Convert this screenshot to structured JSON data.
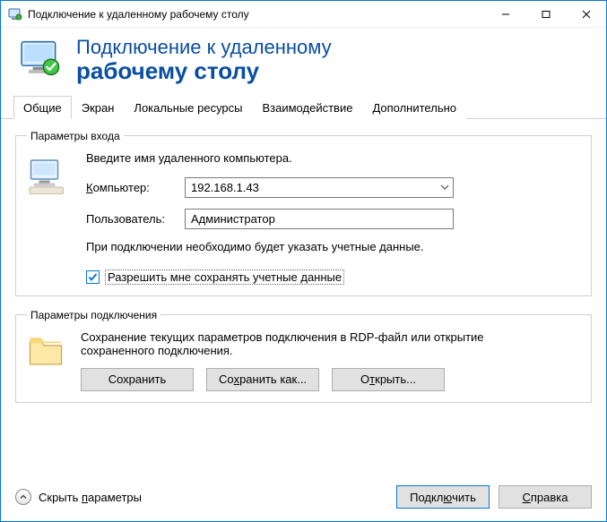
{
  "window": {
    "title": "Подключение к удаленному рабочему столу"
  },
  "header": {
    "line1": "Подключение к удаленному",
    "line2": "рабочему столу"
  },
  "tabs": {
    "items": [
      {
        "label": "Общие",
        "active": true
      },
      {
        "label": "Экран",
        "active": false
      },
      {
        "label": "Локальные ресурсы",
        "active": false
      },
      {
        "label": "Взаимодействие",
        "active": false
      },
      {
        "label": "Дополнительно",
        "active": false
      }
    ]
  },
  "login_group": {
    "legend": "Параметры входа",
    "instruction": "Введите имя удаленного компьютера.",
    "computer_label": "Компьютер:",
    "computer_value": "192.168.1.43",
    "user_label": "Пользователь:",
    "user_value": "Администратор",
    "note": "При подключении необходимо будет указать учетные данные.",
    "checkbox_checked": true,
    "checkbox_label": "Разрешить мне сохранять учетные данные"
  },
  "conn_group": {
    "legend": "Параметры подключения",
    "text": "Сохранение текущих параметров подключения в RDP-файл или открытие сохраненного подключения.",
    "save": "Сохранить",
    "save_as": "Сохранить как...",
    "open": "Открыть..."
  },
  "footer": {
    "hide_options": "Скрыть параметры",
    "connect": "Подключить",
    "help": "Справка"
  }
}
